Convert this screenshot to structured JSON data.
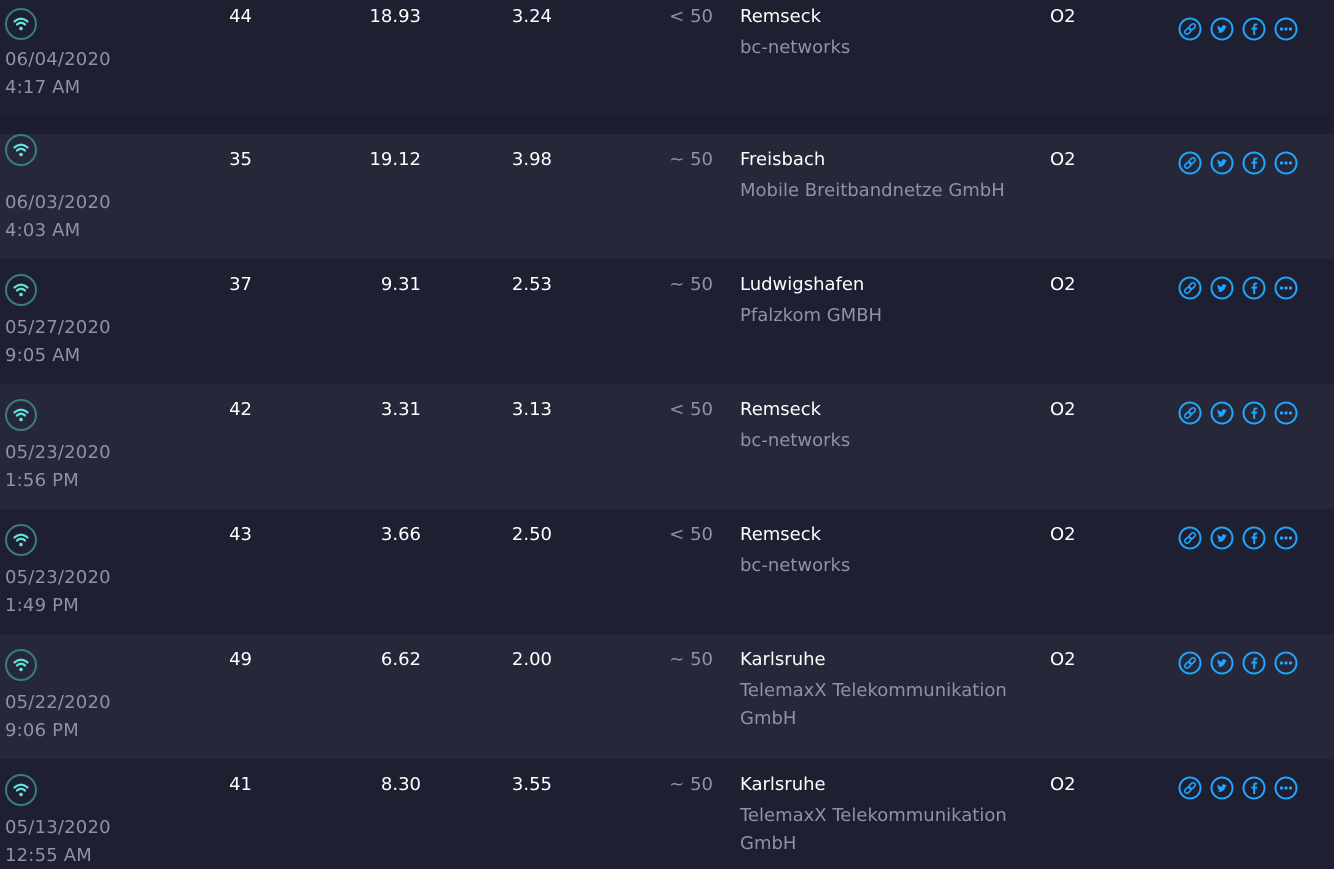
{
  "colors": {
    "background": "#1c1d2e",
    "row_alt": "#262839",
    "accent": "#1fa6ff",
    "wifi_icon": "#5fe5d9",
    "text_primary": "#ffffff",
    "text_secondary": "#8f92a6"
  },
  "row_icons": {
    "connection": "wifi-icon",
    "actions": [
      "link-icon",
      "twitter-icon",
      "facebook-icon",
      "more-icon"
    ]
  },
  "results": [
    {
      "date": "06/04/2020",
      "time": "4:17 AM",
      "ping": "44",
      "download": "18.93",
      "upload": "3.24",
      "distance": "< 50",
      "location": "Remseck",
      "isp": "bc-networks",
      "provider": "O2"
    },
    {
      "date": "06/03/2020",
      "time": "4:03 AM",
      "ping": "35",
      "download": "19.12",
      "upload": "3.98",
      "distance": "~ 50",
      "location": "Freisbach",
      "isp": "Mobile Breitbandnetze GmbH",
      "provider": "O2"
    },
    {
      "date": "05/27/2020",
      "time": "9:05 AM",
      "ping": "37",
      "download": "9.31",
      "upload": "2.53",
      "distance": "~ 50",
      "location": "Ludwigshafen",
      "isp": "Pfalzkom GMBH",
      "provider": "O2"
    },
    {
      "date": "05/23/2020",
      "time": "1:56 PM",
      "ping": "42",
      "download": "3.31",
      "upload": "3.13",
      "distance": "< 50",
      "location": "Remseck",
      "isp": "bc-networks",
      "provider": "O2"
    },
    {
      "date": "05/23/2020",
      "time": "1:49 PM",
      "ping": "43",
      "download": "3.66",
      "upload": "2.50",
      "distance": "< 50",
      "location": "Remseck",
      "isp": "bc-networks",
      "provider": "O2"
    },
    {
      "date": "05/22/2020",
      "time": "9:06 PM",
      "ping": "49",
      "download": "6.62",
      "upload": "2.00",
      "distance": "~ 50",
      "location": "Karlsruhe",
      "isp": "TelemaxX Telekommunikation GmbH",
      "provider": "O2"
    },
    {
      "date": "05/13/2020",
      "time": "12:55 AM",
      "ping": "41",
      "download": "8.30",
      "upload": "3.55",
      "distance": "~ 50",
      "location": "Karlsruhe",
      "isp": "TelemaxX Telekommunikation GmbH",
      "provider": "O2"
    }
  ]
}
